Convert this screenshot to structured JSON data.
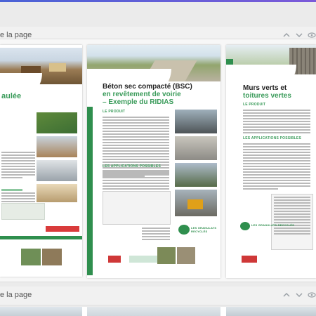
{
  "section1": {
    "label": "e la page"
  },
  "section2": {
    "label": "e la page"
  },
  "left_page": {
    "title": "aulée"
  },
  "center_page": {
    "title": "Béton sec compacté (BSC)",
    "subtitle_line1": "en revêtement de voirie",
    "subtitle_line2": "– Exemple du RIDIAS",
    "section_a": "LE PRODUIT",
    "section_b": "LES APPLICATIONS POSSIBLES",
    "footer_logo": "LES GRANULATS RECYCLÉS"
  },
  "right_page": {
    "title_line1": "Murs verts et",
    "title_line2": "toitures vertes",
    "section_a": "LE PRODUIT",
    "section_b": "LES APPLICATIONS POSSIBLES",
    "footer_logo": "LES GRANULATS RECYCLÉS"
  },
  "icons": [
    "chevron-up-icon",
    "chevron-down-icon",
    "eye-icon"
  ]
}
